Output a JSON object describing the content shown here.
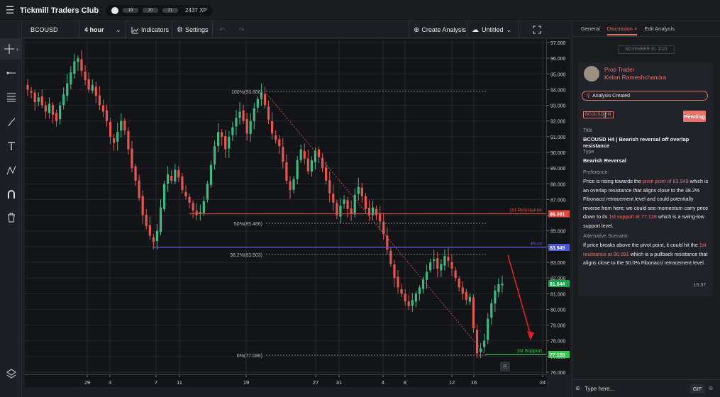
{
  "app": {
    "title": "Tickmill Traders Club",
    "levels": [
      "19",
      "20",
      "21"
    ],
    "xp": "2437 XP"
  },
  "icons": {
    "menu": "hamburger-icon",
    "crosshair": "crosshair-icon",
    "line": "trend-line-icon",
    "fib": "fib-retracement-icon",
    "brush": "brush-icon",
    "text": "text-icon",
    "pattern": "pattern-icon",
    "magnet": "magnet-icon",
    "trash": "trash-icon",
    "layers": "layers-icon"
  },
  "toolbar": {
    "symbol": "BCOUSD",
    "interval": "4 hour",
    "indicators": "Indicators",
    "settings": "Settings",
    "create_analysis": "Create Analysis",
    "layout_name": "Untitled"
  },
  "chart_data": {
    "type": "candlestick",
    "symbol": "BCOUSD",
    "interval": "4 hour",
    "y_ticks": [
      "97.000",
      "96.000",
      "95.000",
      "94.000",
      "93.000",
      "92.000",
      "91.000",
      "90.000",
      "89.000",
      "88.000",
      "87.000",
      "86.000",
      "85.000",
      "84.000",
      "83.000",
      "82.000",
      "81.000",
      "80.000",
      "79.000",
      "78.000",
      "77.000",
      "76.000"
    ],
    "ylim": [
      75.9,
      97.0
    ],
    "x_ticks": [
      "29",
      "3",
      "7",
      "11",
      "19",
      "27",
      "31",
      "4",
      "8",
      "12",
      "16",
      "24"
    ],
    "close_path": [
      94.0,
      93.8,
      93.2,
      93.5,
      93.0,
      92.6,
      93.1,
      92.4,
      92.0,
      93.0,
      93.7,
      94.4,
      95.1,
      95.8,
      96.0,
      95.2,
      94.6,
      94.0,
      94.3,
      93.6,
      93.0,
      92.6,
      92.0,
      91.0,
      90.6,
      91.3,
      92.0,
      91.4,
      90.2,
      89.0,
      88.2,
      87.1,
      86.0,
      85.3,
      84.7,
      84.3,
      85.0,
      86.5,
      88.0,
      88.6,
      88.2,
      88.9,
      88.4,
      87.6,
      87.2,
      86.8,
      86.3,
      86.0,
      86.2,
      86.9,
      88.0,
      89.2,
      90.4,
      91.3,
      91.0,
      90.2,
      91.0,
      91.6,
      92.2,
      92.6,
      92.0,
      91.2,
      92.0,
      92.8,
      93.4,
      93.8,
      93.0,
      92.1,
      91.2,
      90.8,
      90.4,
      89.4,
      88.2,
      87.6,
      88.3,
      89.5,
      90.2,
      89.6,
      88.8,
      89.5,
      90.1,
      89.7,
      89.0,
      88.2,
      87.4,
      86.8,
      86.0,
      86.6,
      87.0,
      86.4,
      86.1,
      87.3,
      87.8,
      87.2,
      86.4,
      86.0,
      86.5,
      86.0,
      85.6,
      84.8,
      83.8,
      82.9,
      82.0,
      81.4,
      81.0,
      80.5,
      80.2,
      80.6,
      81.0,
      81.4,
      81.9,
      82.4,
      83.0,
      83.2,
      82.6,
      82.9,
      83.4,
      83.1,
      82.6,
      82.0,
      81.4,
      81.0,
      80.6,
      80.8,
      78.8,
      77.2,
      77.5,
      78.0,
      79.4,
      80.4,
      81.2,
      81.6,
      81.644
    ],
    "current_price": "81.644",
    "fibonacci": [
      {
        "label": "100%(93.886)",
        "price": 93.886
      },
      {
        "label": "50%(85.486)",
        "price": 85.486
      },
      {
        "label": "38.2%(83.503)",
        "price": 83.503
      },
      {
        "label": "0%(77.086)",
        "price": 77.086
      }
    ],
    "levels": [
      {
        "name": "1st Resistance",
        "price": 86.091,
        "price_label": "86.091",
        "color": "#e2453c"
      },
      {
        "name": "Pivot",
        "price": 83.949,
        "price_label": "83.949",
        "color": "#4a55d6"
      },
      {
        "name": "1st Support",
        "price": 77.128,
        "price_label": "77.128",
        "color": "#35c94b"
      }
    ],
    "current_price_color": "#1aa34a",
    "up_color": "#3fb883",
    "down_color": "#e4574f"
  },
  "panel": {
    "tabs": [
      "General",
      "Discussion",
      "Edit Analysis"
    ],
    "active_tab": "Discussion",
    "date": "NOVEMBER 20, 2023",
    "role": "Prop Trader",
    "author": "Ketan Rameshchandra",
    "created": "Analysis Created",
    "tags": [
      "BCOUSD",
      "H4"
    ],
    "status": "Pending",
    "title_label": "Title",
    "title": "BCOUSD H4 | Bearish reversal off overlap resistance",
    "type_label": "Type",
    "type": "Bearish Reversal",
    "preference_label": "Preference:",
    "preference_pre": "Price is rising towards the ",
    "preference_hl1": "pivot point of 83.949",
    "preference_mid": " which is an overlap resistance that aligns close to the 38.2% Fibonacci retracement level and could potentially reverse from here; we could see momentum carry price down to its ",
    "preference_hl2": "1st support at 77.128",
    "preference_post": " which is a swing-low support level.",
    "alt_label": "Alternative Scenario:",
    "alt_pre": "If price breaks above the pivot point, it could hit the ",
    "alt_hl": "1st resistance at 86.091",
    "alt_post": " which is a pullback resistance that aligns close to the 50.0% Fibonacci retracement level.",
    "time": "15:37",
    "composer_placeholder": "Type here...",
    "gif": "GIF"
  },
  "accent": "#e8726a"
}
